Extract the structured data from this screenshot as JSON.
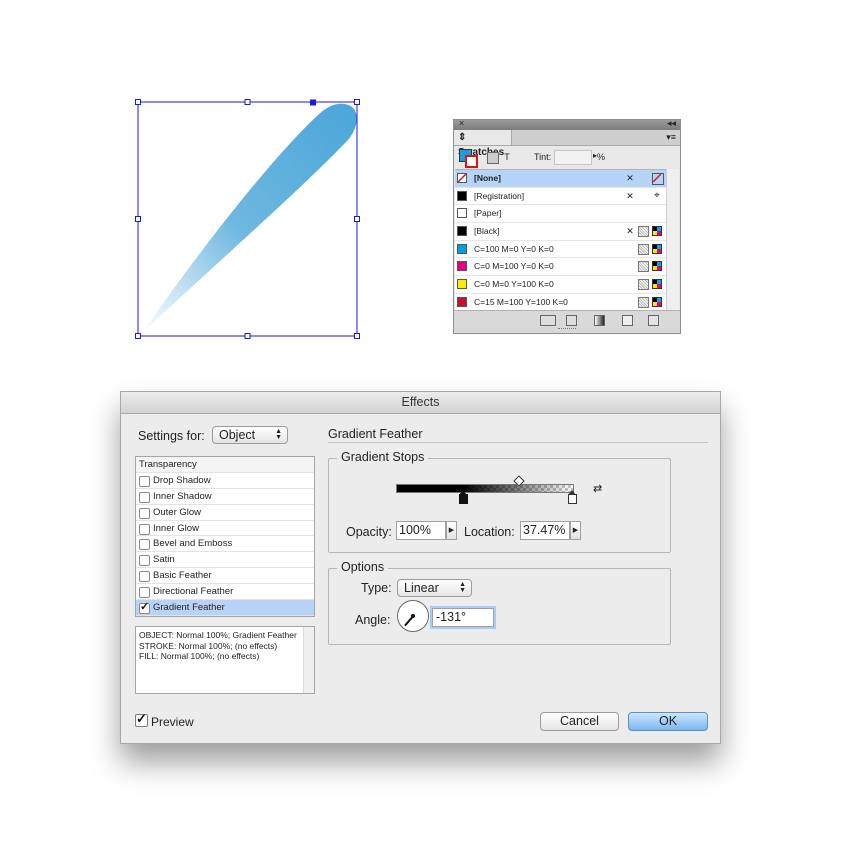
{
  "swatches_panel": {
    "close_glyph": "×",
    "collapse_glyph": "◂◂",
    "tab_label": "Swatches",
    "tab_glyph": "⇕",
    "menu_glyph": "▾≡",
    "tint_label": "Tint:",
    "tint_value": "",
    "tint_unit": "%",
    "text_icon": "T",
    "items": [
      {
        "name": "[None]",
        "color": "none",
        "selected": true
      },
      {
        "name": "[Registration]",
        "color": "#000000"
      },
      {
        "name": "[Paper]",
        "color": "#ffffff"
      },
      {
        "name": "[Black]",
        "color": "#000000"
      },
      {
        "name": "C=100 M=0 Y=0 K=0",
        "color": "#00a0e3"
      },
      {
        "name": "C=0 M=100 Y=0 K=0",
        "color": "#e6007e"
      },
      {
        "name": "C=0 M=0 Y=100 K=0",
        "color": "#ffed00"
      },
      {
        "name": "C=15 M=100 Y=100 K=0",
        "color": "#c8102e"
      }
    ]
  },
  "dialog": {
    "title": "Effects",
    "settings_for_label": "Settings for:",
    "settings_for_value": "Object",
    "effects": [
      {
        "label": "Transparency",
        "header": true
      },
      {
        "label": "Drop Shadow",
        "checked": false
      },
      {
        "label": "Inner Shadow",
        "checked": false
      },
      {
        "label": "Outer Glow",
        "checked": false
      },
      {
        "label": "Inner Glow",
        "checked": false
      },
      {
        "label": "Bevel and Emboss",
        "checked": false
      },
      {
        "label": "Satin",
        "checked": false
      },
      {
        "label": "Basic Feather",
        "checked": false
      },
      {
        "label": "Directional Feather",
        "checked": false
      },
      {
        "label": "Gradient Feather",
        "checked": true,
        "selected": true
      }
    ],
    "summary_lines": [
      "OBJECT: Normal 100%; Gradient Feather",
      "STROKE: Normal 100%; (no effects)",
      "FILL: Normal 100%; (no effects)"
    ],
    "section_title": "Gradient Feather",
    "gradient_stops": {
      "legend": "Gradient Stops",
      "opacity_label": "Opacity:",
      "opacity_value": "100%",
      "location_label": "Location:",
      "location_value": "37.47%"
    },
    "options": {
      "legend": "Options",
      "type_label": "Type:",
      "type_value": "Linear",
      "angle_label": "Angle:",
      "angle_value": "-131°"
    },
    "preview_label": "Preview",
    "preview_checked": true,
    "cancel_label": "Cancel",
    "ok_label": "OK",
    "accent_color": "#7db7f0"
  },
  "artwork": {
    "shape_color": "#4aa6d9",
    "selection_color": "#1a1adb"
  }
}
